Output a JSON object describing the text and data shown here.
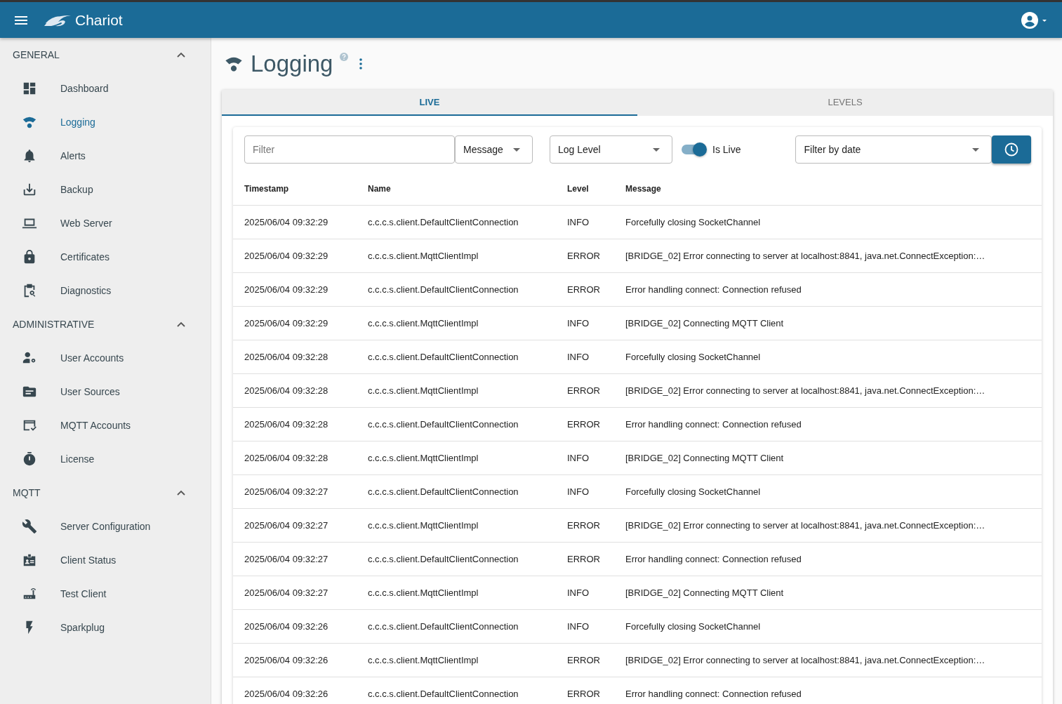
{
  "app_bar": {
    "brand": "Chariot"
  },
  "sidebar": {
    "sections": [
      {
        "title": "GENERAL",
        "expanded": true,
        "items": [
          {
            "label": "Dashboard",
            "selected": false
          },
          {
            "label": "Logging",
            "selected": true
          },
          {
            "label": "Alerts",
            "selected": false
          },
          {
            "label": "Backup",
            "selected": false
          },
          {
            "label": "Web Server",
            "selected": false
          },
          {
            "label": "Certificates",
            "selected": false
          },
          {
            "label": "Diagnostics",
            "selected": false
          }
        ]
      },
      {
        "title": "ADMINISTRATIVE",
        "expanded": true,
        "items": [
          {
            "label": "User Accounts",
            "selected": false
          },
          {
            "label": "User Sources",
            "selected": false
          },
          {
            "label": "MQTT Accounts",
            "selected": false
          },
          {
            "label": "License",
            "selected": false
          }
        ]
      },
      {
        "title": "MQTT",
        "expanded": true,
        "items": [
          {
            "label": "Server Configuration",
            "selected": false
          },
          {
            "label": "Client Status",
            "selected": false
          },
          {
            "label": "Test Client",
            "selected": false
          },
          {
            "label": "Sparkplug",
            "selected": false
          }
        ]
      }
    ]
  },
  "page": {
    "title": "Logging"
  },
  "tabs": [
    {
      "label": "LIVE",
      "selected": true
    },
    {
      "label": "LEVELS",
      "selected": false
    }
  ],
  "filters": {
    "filter": {
      "placeholder": "Filter"
    },
    "field_select": {
      "value": "Message"
    },
    "level_select": {
      "value": "Log Level"
    },
    "live_toggle": {
      "label": "Is Live",
      "on": true
    },
    "date_select": {
      "value": "Filter by date"
    }
  },
  "table": {
    "columns": [
      "Timestamp",
      "Name",
      "Level",
      "Message"
    ],
    "rows": [
      [
        "2025/06/04 09:32:29",
        "c.c.c.s.client.DefaultClientConnection",
        "INFO",
        "Forcefully closing SocketChannel"
      ],
      [
        "2025/06/04 09:32:29",
        "c.c.c.s.client.MqttClientImpl",
        "ERROR",
        "[BRIDGE_02] Error connecting to server at localhost:8841, java.net.ConnectException:…"
      ],
      [
        "2025/06/04 09:32:29",
        "c.c.c.s.client.DefaultClientConnection",
        "ERROR",
        "Error handling connect: Connection refused"
      ],
      [
        "2025/06/04 09:32:29",
        "c.c.c.s.client.MqttClientImpl",
        "INFO",
        "[BRIDGE_02] Connecting MQTT Client"
      ],
      [
        "2025/06/04 09:32:28",
        "c.c.c.s.client.DefaultClientConnection",
        "INFO",
        "Forcefully closing SocketChannel"
      ],
      [
        "2025/06/04 09:32:28",
        "c.c.c.s.client.MqttClientImpl",
        "ERROR",
        "[BRIDGE_02] Error connecting to server at localhost:8841, java.net.ConnectException:…"
      ],
      [
        "2025/06/04 09:32:28",
        "c.c.c.s.client.DefaultClientConnection",
        "ERROR",
        "Error handling connect: Connection refused"
      ],
      [
        "2025/06/04 09:32:28",
        "c.c.c.s.client.MqttClientImpl",
        "INFO",
        "[BRIDGE_02] Connecting MQTT Client"
      ],
      [
        "2025/06/04 09:32:27",
        "c.c.c.s.client.DefaultClientConnection",
        "INFO",
        "Forcefully closing SocketChannel"
      ],
      [
        "2025/06/04 09:32:27",
        "c.c.c.s.client.MqttClientImpl",
        "ERROR",
        "[BRIDGE_02] Error connecting to server at localhost:8841, java.net.ConnectException:…"
      ],
      [
        "2025/06/04 09:32:27",
        "c.c.c.s.client.DefaultClientConnection",
        "ERROR",
        "Error handling connect: Connection refused"
      ],
      [
        "2025/06/04 09:32:27",
        "c.c.c.s.client.MqttClientImpl",
        "INFO",
        "[BRIDGE_02] Connecting MQTT Client"
      ],
      [
        "2025/06/04 09:32:26",
        "c.c.c.s.client.DefaultClientConnection",
        "INFO",
        "Forcefully closing SocketChannel"
      ],
      [
        "2025/06/04 09:32:26",
        "c.c.c.s.client.MqttClientImpl",
        "ERROR",
        "[BRIDGE_02] Error connecting to server at localhost:8841, java.net.ConnectException:…"
      ],
      [
        "2025/06/04 09:32:26",
        "c.c.c.s.client.DefaultClientConnection",
        "ERROR",
        "Error handling connect: Connection refused"
      ]
    ]
  }
}
